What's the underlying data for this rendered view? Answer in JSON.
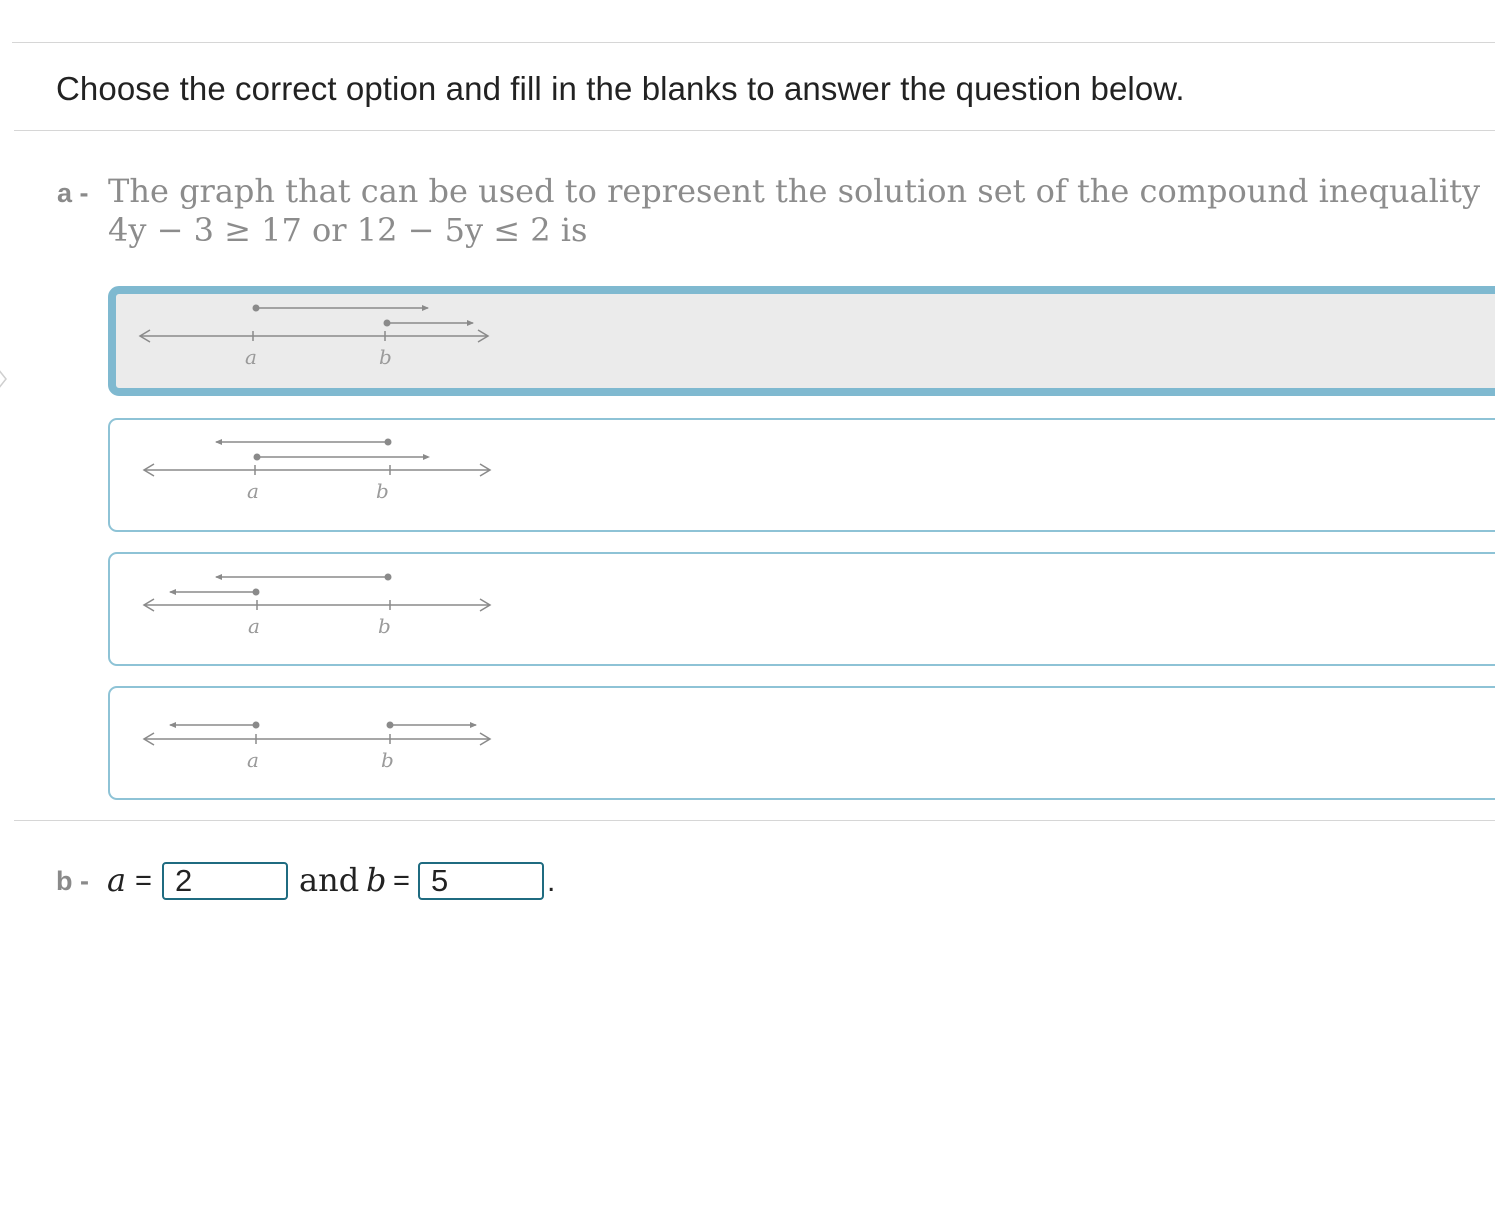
{
  "instruction": "Choose the correct option and fill in the blanks to answer the question below.",
  "part_a": {
    "label": "a -",
    "question_line1": "The graph that can be used to represent the solution set of the compound inequality",
    "inequality_1": "4y − 3 ≥ 17",
    "connector": "or",
    "inequality_2": "12 − 5y ≤ 2",
    "suffix": "is"
  },
  "options": [
    {
      "id": "option-1",
      "selected": true,
      "point_a": "a",
      "point_b": "b"
    },
    {
      "id": "option-2",
      "selected": false,
      "point_a": "a",
      "point_b": "b"
    },
    {
      "id": "option-3",
      "selected": false,
      "point_a": "a",
      "point_b": "b"
    },
    {
      "id": "option-4",
      "selected": false,
      "point_a": "a",
      "point_b": "b"
    }
  ],
  "part_b": {
    "label": "b -",
    "var_a": "a",
    "equals": "=",
    "value_a": "2",
    "and_text": "and",
    "var_b": "b",
    "value_b": "5",
    "period": "."
  },
  "colors": {
    "option_border": "#8ec3d6",
    "selected_border": "#7fb9d0",
    "selected_fill": "#ebebeb",
    "input_border": "#1f6b80",
    "line_gray": "#8a8a8a"
  }
}
